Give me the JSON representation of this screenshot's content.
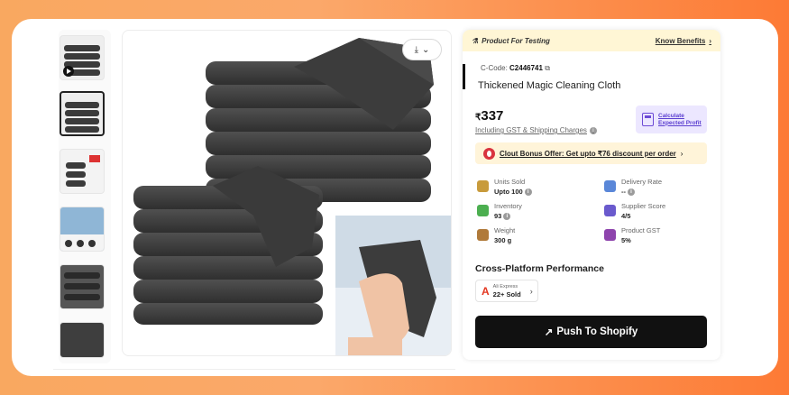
{
  "testing_bar": {
    "label": "Product For Testing",
    "link": "Know Benefits"
  },
  "product": {
    "code_label": "C-Code:",
    "code": "C2446741",
    "title": "Thickened Magic Cleaning Cloth",
    "currency": "₹",
    "price": "337",
    "price_note": "Including GST & Shipping Charges",
    "calc_line1": "Calculate",
    "calc_line2": "Expected Profit",
    "bonus": "Clout Bonus Offer: Get upto ₹76 discount per order"
  },
  "stats": [
    {
      "label": "Units Sold",
      "value": "Upto 100",
      "icon": "box-icon",
      "color": "#c89b3c",
      "info": true
    },
    {
      "label": "Delivery Rate",
      "value": "--",
      "icon": "truck-icon",
      "color": "#5a87d8",
      "info": true
    },
    {
      "label": "Inventory",
      "value": "93",
      "icon": "cube-icon",
      "color": "#4caf50",
      "info": true
    },
    {
      "label": "Supplier Score",
      "value": "4/5",
      "icon": "shield-icon",
      "color": "#6a5acd",
      "info": false
    },
    {
      "label": "Weight",
      "value": "300 g",
      "icon": "weight-icon",
      "color": "#b07a3a",
      "info": false
    },
    {
      "label": "Product GST",
      "value": "5%",
      "icon": "percent-doc-icon",
      "color": "#8e44ad",
      "info": false
    }
  ],
  "cross_platform": {
    "heading": "Cross-Platform Performance",
    "platform_name": "Ali Express",
    "platform_sold": "22+ Sold"
  },
  "push_button": "Push To Shopify",
  "thumbnails": [
    {
      "icon": "video-thumbnail",
      "has_video": true
    },
    {
      "icon": "product-thumbnail",
      "active": true
    },
    {
      "icon": "product-thumbnail"
    },
    {
      "icon": "product-thumbnail"
    },
    {
      "icon": "product-thumbnail"
    },
    {
      "icon": "product-thumbnail"
    }
  ],
  "colors": {
    "accent": "#5b3fd0",
    "push_bg": "#111111",
    "testing_bg": "#fff6d5",
    "bonus_bg": "#fff4d9"
  }
}
